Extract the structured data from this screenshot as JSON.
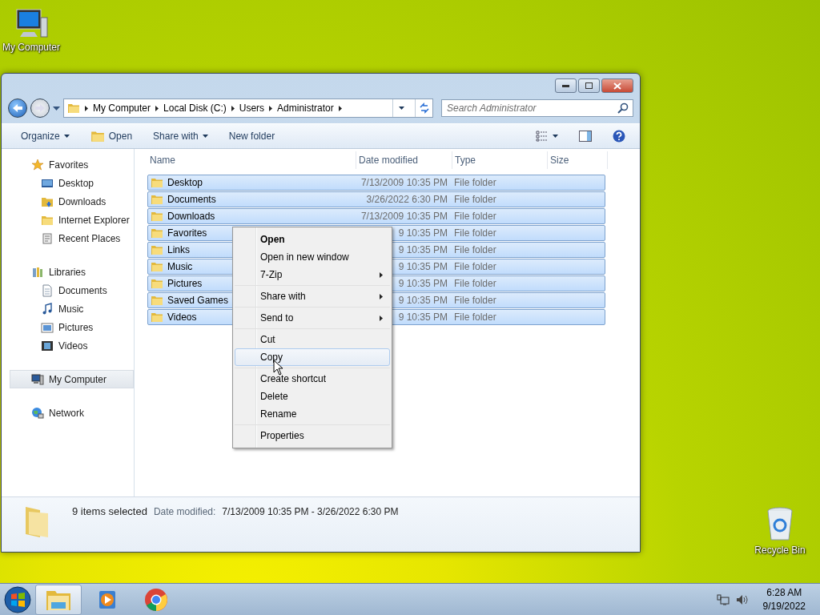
{
  "desktop_icons": [
    {
      "label": "My Computer",
      "kind": "computer"
    },
    {
      "label": "Recycle Bin",
      "kind": "bin"
    }
  ],
  "window": {
    "breadcrumb": [
      "My Computer",
      "Local Disk (C:)",
      "Users",
      "Administrator"
    ],
    "search": {
      "placeholder": "Search Administrator"
    },
    "toolbar": [
      {
        "label": "Organize",
        "kind": "menu"
      },
      {
        "label": "Open",
        "kind": "open"
      },
      {
        "label": "Share with",
        "kind": "menu"
      },
      {
        "label": "New folder",
        "kind": "plain"
      }
    ],
    "sidebar": [
      {
        "label": "Favorites",
        "kind": "star",
        "selected": false,
        "children": [
          {
            "label": "Desktop",
            "kind": "desktop",
            "selected": false
          },
          {
            "label": "Downloads",
            "kind": "download",
            "selected": false
          },
          {
            "label": "Internet Explorer",
            "kind": "folder",
            "selected": false
          },
          {
            "label": "Recent Places",
            "kind": "recent",
            "selected": false
          }
        ]
      },
      {
        "label": "Libraries",
        "kind": "library",
        "selected": false,
        "children": [
          {
            "label": "Documents",
            "kind": "document",
            "selected": false
          },
          {
            "label": "Music",
            "kind": "music",
            "selected": false
          },
          {
            "label": "Pictures",
            "kind": "picture",
            "selected": false
          },
          {
            "label": "Videos",
            "kind": "video",
            "selected": false
          }
        ]
      },
      {
        "label": "My Computer",
        "kind": "computer",
        "selected": true
      },
      {
        "label": "Network",
        "kind": "network",
        "selected": false
      }
    ],
    "columns": [
      "Name",
      "Date modified",
      "Type",
      "Size"
    ],
    "rows": [
      {
        "name": "Desktop",
        "date": "7/13/2009 10:35 PM",
        "type": "File folder",
        "selected": true
      },
      {
        "name": "Documents",
        "date": "3/26/2022 6:30 PM",
        "type": "File folder",
        "selected": true
      },
      {
        "name": "Downloads",
        "date": "7/13/2009 10:35 PM",
        "type": "File folder",
        "selected": true
      },
      {
        "name": "Favorites",
        "date": "9 10:35 PM",
        "type": "File folder",
        "selected": true
      },
      {
        "name": "Links",
        "date": "9 10:35 PM",
        "type": "File folder",
        "selected": true
      },
      {
        "name": "Music",
        "date": "9 10:35 PM",
        "type": "File folder",
        "selected": true
      },
      {
        "name": "Pictures",
        "date": "9 10:35 PM",
        "type": "File folder",
        "selected": true
      },
      {
        "name": "Saved Games",
        "date": "9 10:35 PM",
        "type": "File folder",
        "selected": true
      },
      {
        "name": "Videos",
        "date": "9 10:35 PM",
        "type": "File folder",
        "selected": true
      }
    ],
    "details": {
      "count": "9 items selected",
      "date_label": "Date modified:",
      "date_value": "7/13/2009 10:35 PM - 3/26/2022 6:30 PM"
    }
  },
  "context_menu": [
    [
      {
        "label": "Open",
        "default": true,
        "submenu": false,
        "selected": false
      },
      {
        "label": "Open in new window",
        "default": false,
        "submenu": false,
        "selected": false
      },
      {
        "label": "7-Zip",
        "default": false,
        "submenu": true,
        "selected": false
      }
    ],
    [
      {
        "label": "Share with",
        "default": false,
        "submenu": true,
        "selected": false
      }
    ],
    [
      {
        "label": "Send to",
        "default": false,
        "submenu": true,
        "selected": false
      }
    ],
    [
      {
        "label": "Cut",
        "default": false,
        "submenu": false,
        "selected": false
      },
      {
        "label": "Copy",
        "default": false,
        "submenu": false,
        "selected": true
      }
    ],
    [
      {
        "label": "Create shortcut",
        "default": false,
        "submenu": false,
        "selected": false
      },
      {
        "label": "Delete",
        "default": false,
        "submenu": false,
        "selected": false
      },
      {
        "label": "Rename",
        "default": false,
        "submenu": false,
        "selected": false
      }
    ],
    [
      {
        "label": "Properties",
        "default": false,
        "submenu": false,
        "selected": false
      }
    ]
  ],
  "taskbar": {
    "apps": [
      {
        "kind": "explorer",
        "selected": true
      },
      {
        "kind": "media",
        "selected": false
      },
      {
        "kind": "browser",
        "selected": false
      }
    ],
    "time": "6:28 AM",
    "date": "9/19/2022"
  }
}
